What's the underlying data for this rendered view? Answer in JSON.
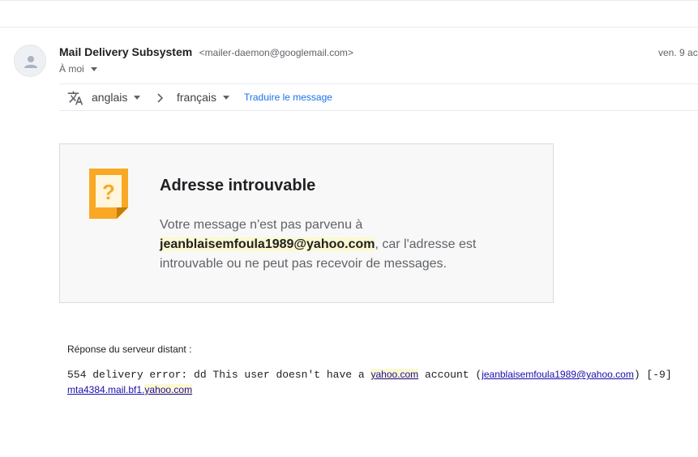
{
  "sender": {
    "name": "Mail Delivery Subsystem",
    "email": "<mailer-daemon@googlemail.com>"
  },
  "date": "ven. 9 ac",
  "recipient": "À moi",
  "translate": {
    "source_lang": "anglais",
    "target_lang": "français",
    "link": "Traduire le message"
  },
  "bounce": {
    "title": "Adresse introuvable",
    "intro": "Votre message n'est pas parvenu à ",
    "email": "jeanblaisemfoula1989@yahoo.com",
    "reason": ", car l'adresse est introuvable ou ne peut pas recevoir de messages."
  },
  "server": {
    "label": "Réponse du serveur distant :",
    "part1": "554 delivery error: dd This user doesn't have a ",
    "domain": "yahoo.com",
    "part2": " account (",
    "email_link": "jeanblaisemfoula1989@yahoo.com",
    "part3": ") [-9]",
    "host_prefix": "mta4384.mail.bf1.",
    "host_domain": "yahoo.com"
  },
  "colors": {
    "link_blue": "#1a73e8",
    "warning_orange": "#f9a825",
    "highlight": "#fcf8d0"
  }
}
